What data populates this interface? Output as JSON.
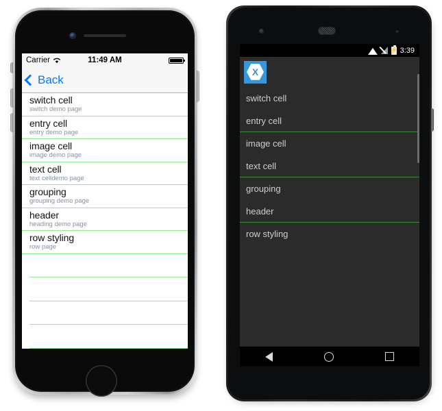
{
  "iphone": {
    "status_bar": {
      "carrier": "Carrier",
      "wifi_icon": "wifi-icon",
      "time": "11:49 AM",
      "battery_icon": "battery-full-icon"
    },
    "nav_bar": {
      "back_label": "Back",
      "back_chevron_icon": "chevron-left-icon",
      "back_color": "#007aff"
    },
    "list": {
      "separator_color": "#90ee90",
      "detail_color": "#8592a8",
      "rows": [
        {
          "title": "switch cell",
          "detail": "switch demo page"
        },
        {
          "title": "entry cell",
          "detail": "entry demo page"
        },
        {
          "title": "image cell",
          "detail": "image demo page"
        },
        {
          "title": "text cell",
          "detail": "text celldemo page"
        },
        {
          "title": "grouping",
          "detail": "grouping demo page"
        },
        {
          "title": "header",
          "detail": "heading demo page"
        },
        {
          "title": "row styling",
          "detail": "row page"
        }
      ],
      "empty_rows": 4
    }
  },
  "android": {
    "status_bar": {
      "wifi_icon": "wifi-icon",
      "signal_off_icon": "signal-no-service-icon",
      "battery_icon": "battery-charging-icon",
      "battery_glyph": "⚡",
      "time": "3:39"
    },
    "app_bar": {
      "logo_icon": "xamarin-logo-icon",
      "logo_letter": "X",
      "logo_bg": "#3498db"
    },
    "list": {
      "separator_color": "#3c8a3c",
      "background": "#2b2b2b",
      "text_color": "#cfcfcf",
      "rows": [
        {
          "title": "switch cell",
          "divider": false
        },
        {
          "title": "entry cell",
          "divider": true
        },
        {
          "title": "image cell",
          "divider": false
        },
        {
          "title": "text cell",
          "divider": true
        },
        {
          "title": "grouping",
          "divider": false
        },
        {
          "title": "header",
          "divider": true
        },
        {
          "title": "row styling",
          "divider": false
        }
      ]
    },
    "nav_bar": {
      "back_icon": "nav-back-triangle-icon",
      "home_icon": "nav-home-circle-icon",
      "recents_icon": "nav-recents-square-icon"
    }
  }
}
